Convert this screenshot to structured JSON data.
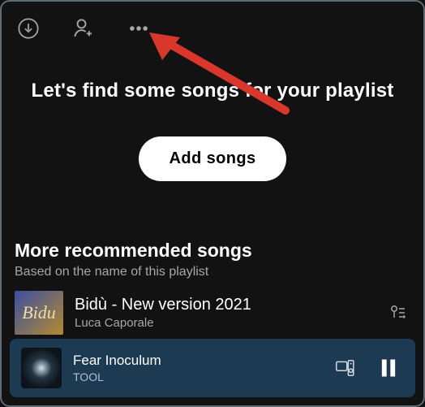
{
  "toolbar": {
    "download_icon": "download-icon",
    "add_user_icon": "add-user-icon",
    "more_icon": "more-options-icon"
  },
  "prompt": {
    "headline": "Let's find some songs for your playlist",
    "add_button": "Add songs"
  },
  "recommended": {
    "title": "More recommended songs",
    "subtitle": "Based on the name of this playlist",
    "items": [
      {
        "title": "Bidù - New version 2021",
        "artist": "Luca Caporale",
        "art_label": "Bidu"
      }
    ]
  },
  "player": {
    "title": "Fear Inoculum",
    "artist": "TOOL",
    "status": "playing"
  },
  "annotation": {
    "type": "arrow",
    "target": "more-options-icon",
    "color": "#d9372c"
  }
}
